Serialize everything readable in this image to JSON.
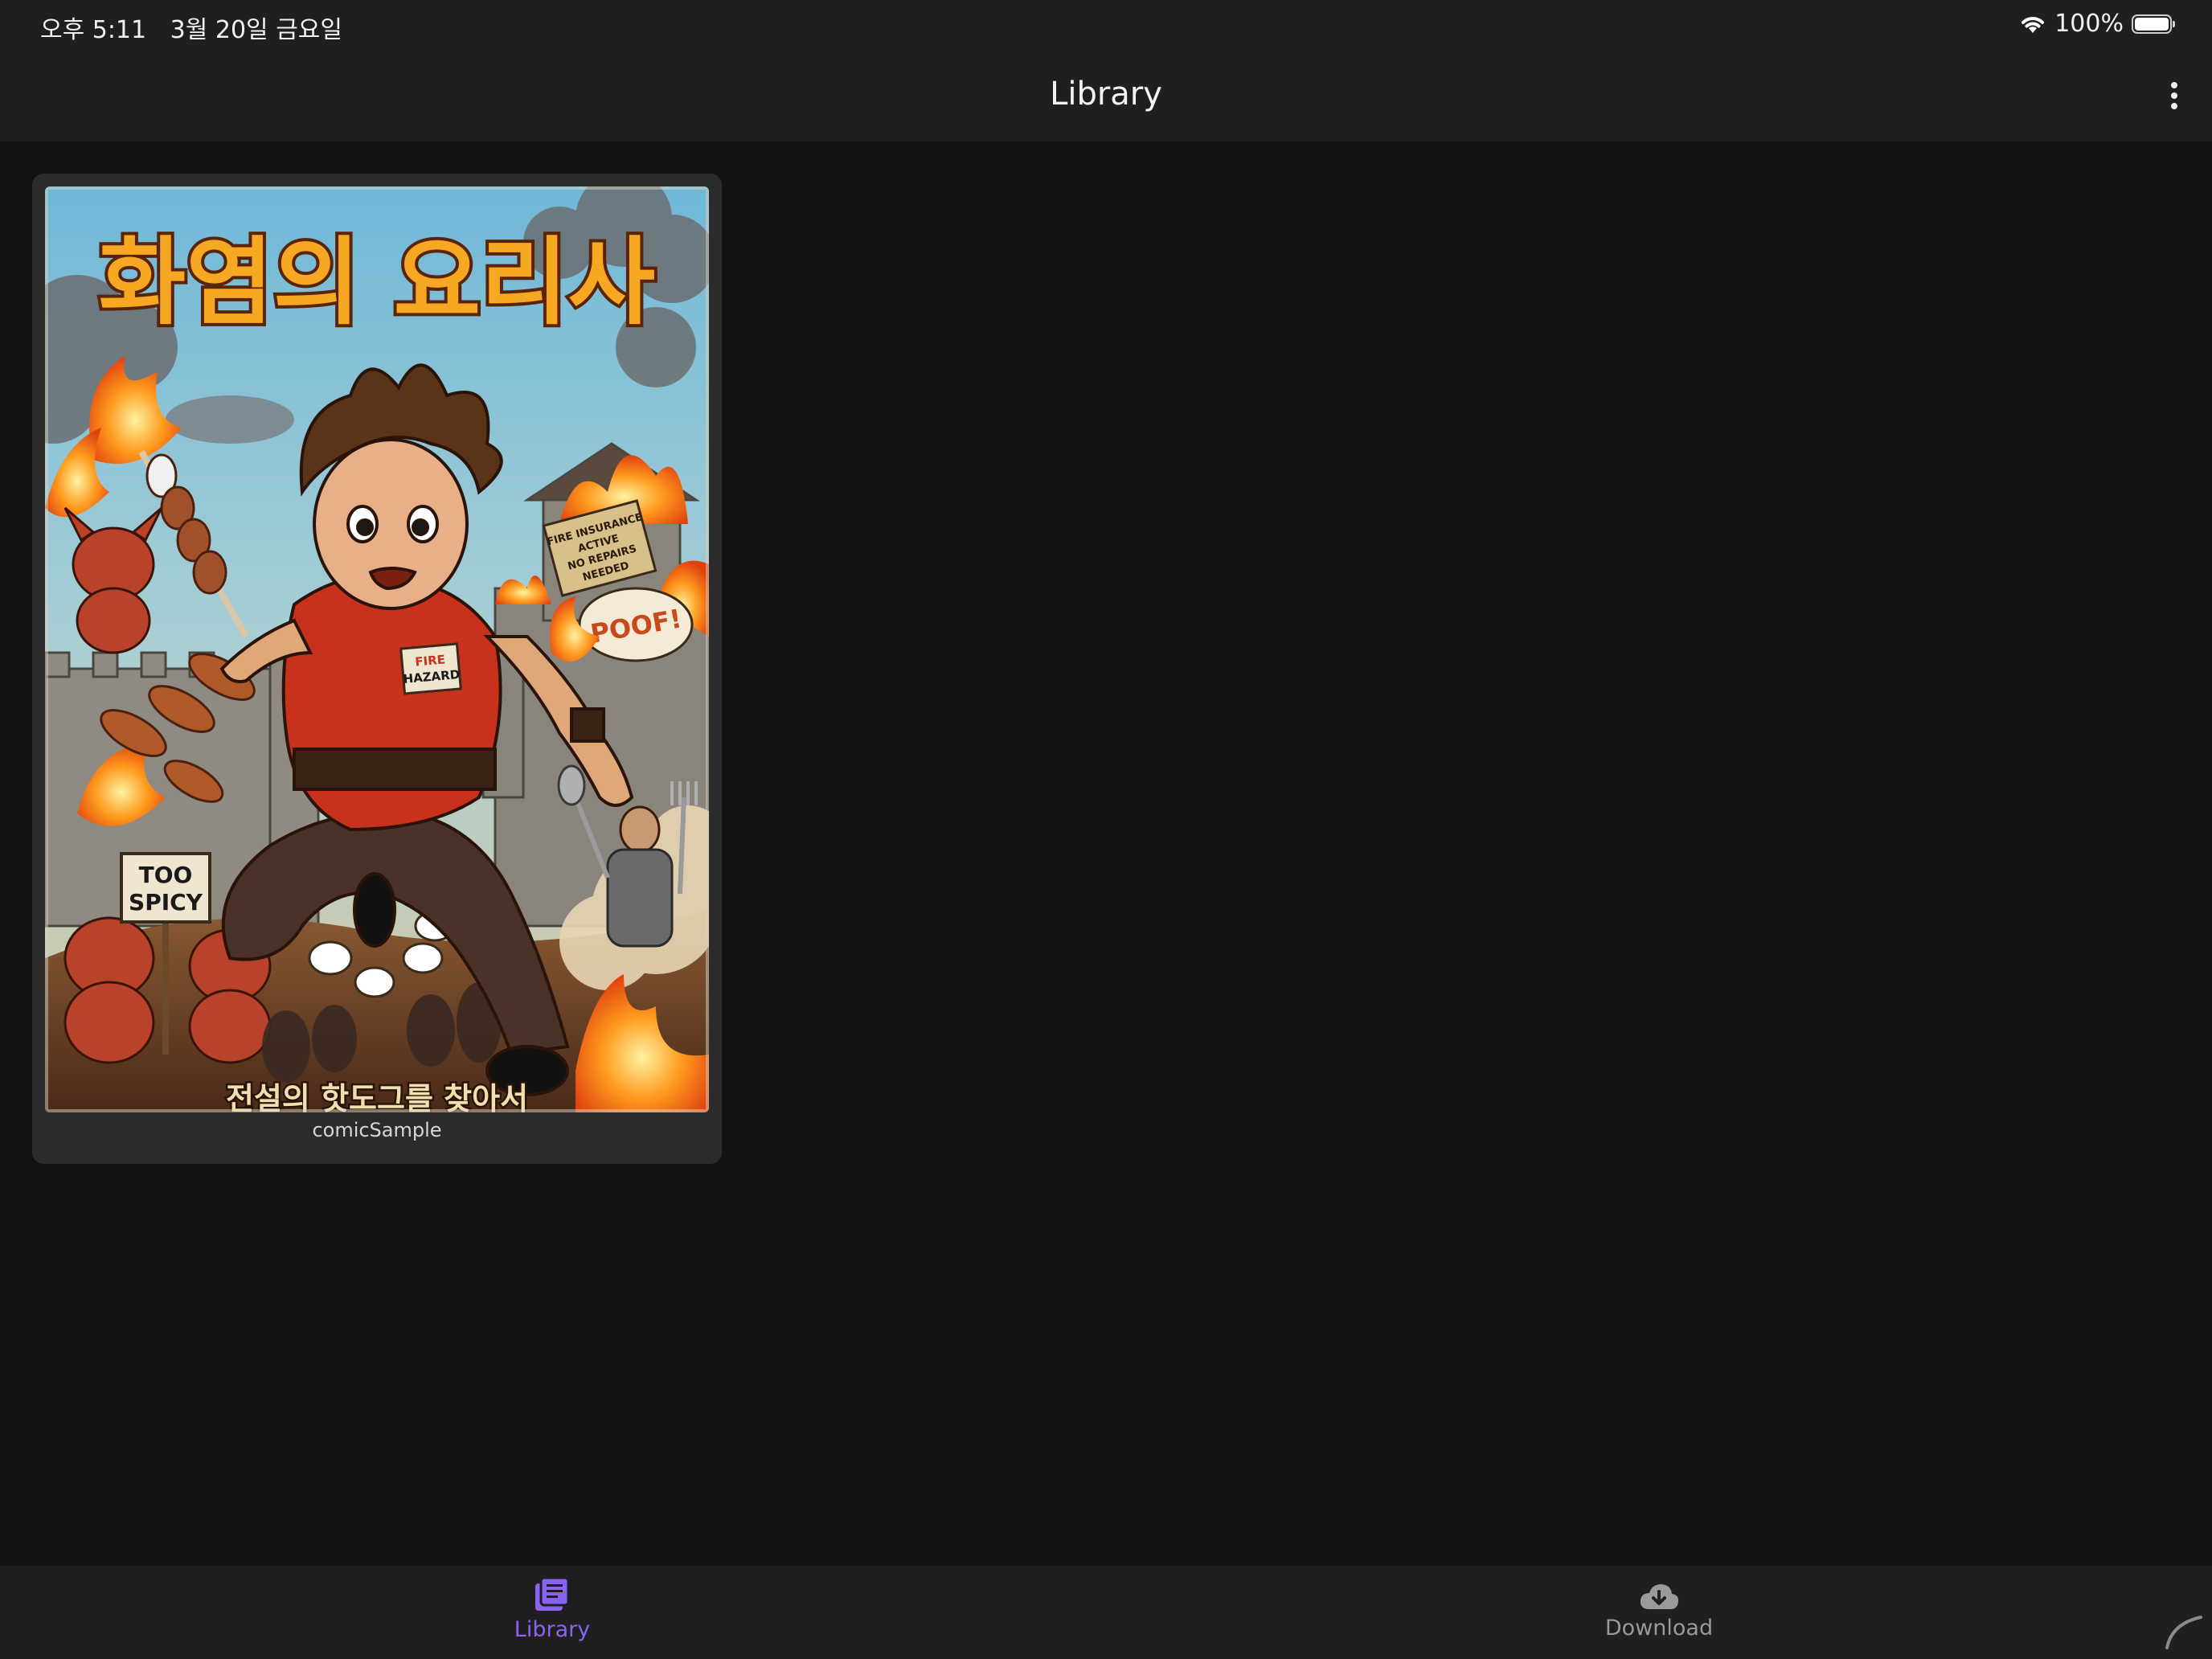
{
  "status_bar": {
    "time": "오후 5:11",
    "date": "3월 20일 금요일",
    "battery_percent": "100%",
    "battery_level": 1.0
  },
  "app_bar": {
    "title": "Library",
    "more_icon": "more-vertical-icon"
  },
  "library": {
    "items": [
      {
        "label": "comicSample",
        "cover": {
          "title": "화염의 요리사",
          "subtitle": "전설의 핫도그를 찾아서",
          "sign_text": [
            "TOO",
            "SPICY"
          ],
          "badge_text": [
            "FIRE",
            "HAZARD"
          ],
          "poof_text": "POOF!",
          "notice_text": [
            "FIRE INSURANCE",
            "ACTIVE",
            "NO REPAIRS",
            "NEEDED"
          ]
        }
      }
    ]
  },
  "bottom_nav": {
    "items": [
      {
        "label": "Library",
        "icon": "library-books-icon",
        "active": true
      },
      {
        "label": "Download",
        "icon": "cloud-download-icon",
        "active": false
      }
    ]
  },
  "colors": {
    "background": "#121212",
    "bar": "#1f1f1f",
    "card": "#2b2b2b",
    "accent": "#8a63f2",
    "inactive": "#9a9a9a"
  }
}
